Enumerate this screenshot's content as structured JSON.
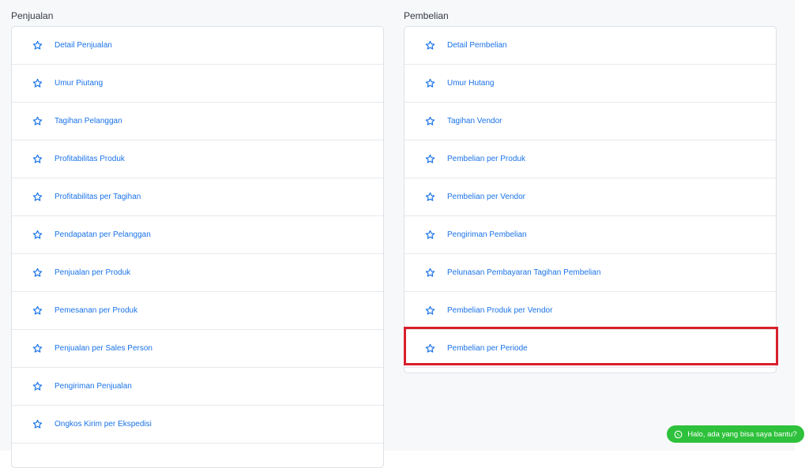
{
  "sections": {
    "penjualan": {
      "title": "Penjualan",
      "items": [
        {
          "label": "Detail Penjualan"
        },
        {
          "label": "Umur Piutang"
        },
        {
          "label": "Tagihan Pelanggan"
        },
        {
          "label": "Profitabilitas Produk"
        },
        {
          "label": "Profitabilitas per Tagihan"
        },
        {
          "label": "Pendapatan per Pelanggan"
        },
        {
          "label": "Penjualan per Produk"
        },
        {
          "label": "Pemesanan per Produk"
        },
        {
          "label": "Penjualan per Sales Person"
        },
        {
          "label": "Pengiriman Penjualan"
        },
        {
          "label": "Ongkos Kirim per Ekspedisi"
        }
      ]
    },
    "pembelian": {
      "title": "Pembelian",
      "items": [
        {
          "label": "Detail Pembelian"
        },
        {
          "label": "Umur Hutang"
        },
        {
          "label": "Tagihan Vendor"
        },
        {
          "label": "Pembelian per Produk"
        },
        {
          "label": "Pembelian per Vendor"
        },
        {
          "label": "Pengiriman Pembelian"
        },
        {
          "label": "Pelunasan Pembayaran Tagihan Pembelian"
        },
        {
          "label": "Pembelian Produk per Vendor"
        },
        {
          "label": "Pembelian per Periode"
        }
      ]
    }
  },
  "chat": {
    "label": "Halo, ada yang bisa saya bantu?",
    "icon": "whatsapp-icon"
  },
  "icons": {
    "row_icon": "star-outline-icon"
  },
  "colors": {
    "link": "#1a73e8",
    "highlight": "#d9202c",
    "chat_bg": "#2ec13b"
  }
}
